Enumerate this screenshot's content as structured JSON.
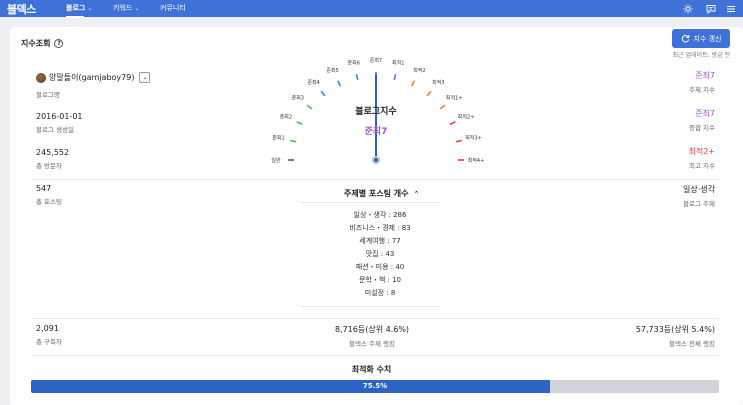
{
  "app": {
    "logo": "블덱스"
  },
  "nav": [
    {
      "label": "블로그",
      "chev": "⌄"
    },
    {
      "label": "키워드",
      "chev": "⌄"
    },
    {
      "label": "커뮤니티",
      "chev": ""
    }
  ],
  "page": {
    "title": "지수조회",
    "help": "?",
    "refresh_label": "지수 갱신",
    "updated": "최근 업데이트:  방금 전"
  },
  "blogger": {
    "name": "양말돌이(gamjaboy79)",
    "name_label": "블로그명",
    "chev": "⌄"
  },
  "left_stats": [
    {
      "value": "2016-01-01",
      "label": "블로그 생성일"
    },
    {
      "value": "245,552",
      "label": "총 방문자"
    },
    {
      "value": "547",
      "label": "총 포스팅"
    }
  ],
  "right_stats": [
    {
      "value": "준최7",
      "label": "주제 지수",
      "color": "#a055d4"
    },
    {
      "value": "준최7",
      "label": "종합 지수",
      "color": "#a055d4"
    },
    {
      "value": "최적2+",
      "label": "최고 지수",
      "color": "#e0433a"
    },
    {
      "value": "일상·생각",
      "label": "블로그 주제",
      "color": "#222222"
    }
  ],
  "gauge": {
    "title": "블로그지수",
    "value": "준최7",
    "ticks": [
      {
        "label": "일반",
        "color": "#555555"
      },
      {
        "label": "준최1",
        "color": "#3ec94a"
      },
      {
        "label": "준최2",
        "color": "#3ec94a"
      },
      {
        "label": "준최3",
        "color": "#3ec94a"
      },
      {
        "label": "준최4",
        "color": "#2a8ec8"
      },
      {
        "label": "준최5",
        "color": "#2a8ec8"
      },
      {
        "label": "준최6",
        "color": "#2a8ec8"
      },
      {
        "label": "준최7",
        "color": "#a055d4"
      },
      {
        "label": "최적1",
        "color": "#a055d4"
      },
      {
        "label": "최적2",
        "color": "#f08a2b"
      },
      {
        "label": "최적3",
        "color": "#f08a2b"
      },
      {
        "label": "최적1+",
        "color": "#f08a2b"
      },
      {
        "label": "최적2+",
        "color": "#e0433a"
      },
      {
        "label": "최적3+",
        "color": "#e0433a"
      },
      {
        "label": "최적4+",
        "color": "#e0433a"
      }
    ],
    "needle_index": 7
  },
  "topics": {
    "title": "주제별 포스팅 개수",
    "chev": "⌃",
    "items": [
      "일상・생각 : 286",
      "비즈니스・경제 : 83",
      "세계여행 : 77",
      "맛집 : 43",
      "패션・미용 : 40",
      "문학・책 : 10",
      "미설정 : 8"
    ]
  },
  "bottom_stats": [
    {
      "value": "2,091",
      "label": "총 구독자"
    },
    {
      "value": "8,716등(상위 4.6%)",
      "label": "블덱스 주제 랭킹"
    },
    {
      "value": "57,733등(상위 5.4%)",
      "label": "블덱스 전체 랭킹"
    }
  ],
  "optimization": {
    "title": "최적화 수치",
    "percent_label": "75.5%",
    "percent": 75.5
  }
}
